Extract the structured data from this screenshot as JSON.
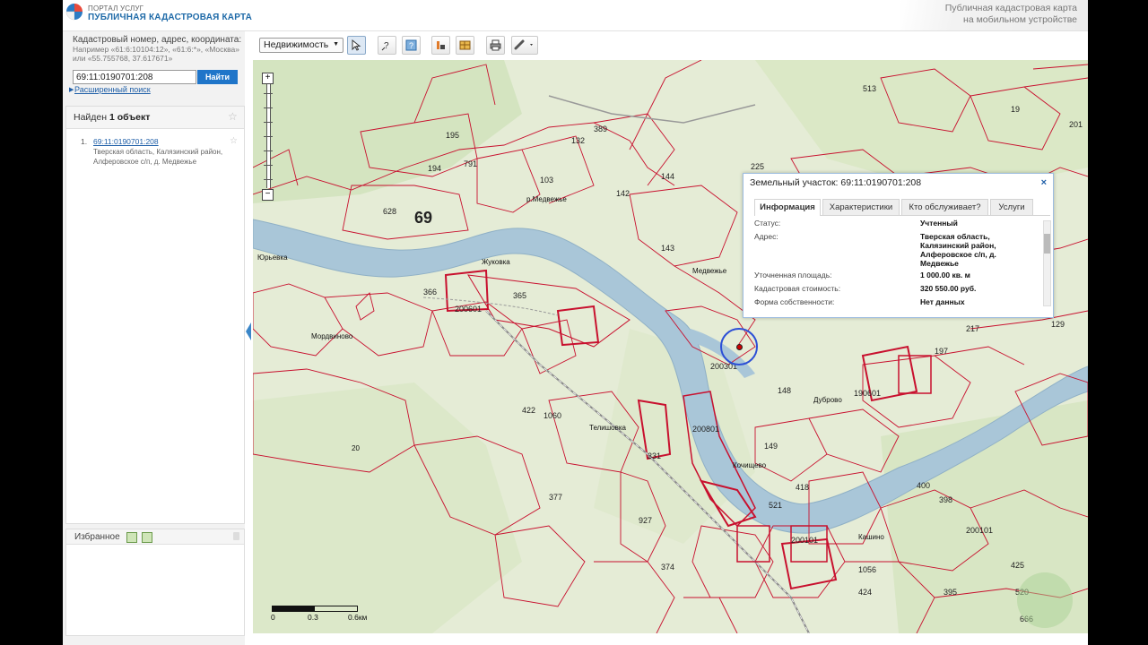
{
  "header": {
    "portal_label": "ПОРТАЛ УСЛУГ",
    "app_title": "ПУБЛИЧНАЯ КАДАСТРОВАЯ КАРТА",
    "mobile_link_line1": "Публичная кадастровая карта",
    "mobile_link_line2": "на мобильном устройстве"
  },
  "search": {
    "hint_title": "Кадастровый номер, адрес, координата:",
    "hint_examples": "Например «61:6:10104:12», «61:6:*», «Москва» или «55.755768, 37.617671»",
    "value": "69:11:0190701:208",
    "button_label": "Найти",
    "advanced_link": "Расширенный поиск"
  },
  "results": {
    "found_prefix": "Найден",
    "found_count": "1 объект",
    "items": [
      {
        "number": "1.",
        "cadastral_number": "69:11:0190701:208",
        "address": "Тверская область, Калязинский район, Алферовское с/п, д. Медвежье"
      }
    ]
  },
  "favorites": {
    "title": "Избранное"
  },
  "toolbar": {
    "layer_select_value": "Недвижимость"
  },
  "map": {
    "region_label": "69",
    "scale_labels": [
      "0",
      "0.3",
      "0.6км"
    ],
    "place_labels": [
      "р.Медвежье",
      "Медвежье",
      "Жуковка",
      "Мордвиново",
      "Юрьевка",
      "Дуброво",
      "Телишовка",
      "Кашино",
      "Кочищево",
      "20"
    ],
    "parcel_labels": [
      "513",
      "19",
      "201",
      "195",
      "389",
      "132",
      "194",
      "791",
      "103",
      "142",
      "144",
      "628",
      "143",
      "366",
      "365",
      "225",
      "197",
      "129",
      "217",
      "148",
      "149",
      "331",
      "377",
      "927",
      "374",
      "1056",
      "424",
      "395",
      "425",
      "666",
      "520",
      "521",
      "418",
      "422",
      "1060",
      "400",
      "398",
      "200101",
      "200101",
      "190601",
      "200801",
      "200301",
      "200601"
    ]
  },
  "popup": {
    "title": "Земельный участок: 69:11:0190701:208",
    "tabs": [
      "Информация",
      "Характеристики",
      "Кто обслуживает?",
      "Услуги"
    ],
    "rows": [
      {
        "key": "Статус:",
        "value": "Учтенный"
      },
      {
        "key": "Адрес:",
        "value": "Тверская область, Калязинский район, Алферовское с/п, д. Медвежье"
      },
      {
        "key": "Уточненная площадь:",
        "value": "1 000.00 кв. м"
      },
      {
        "key": "Кадастровая стоимость:",
        "value": "320 550.00 руб."
      },
      {
        "key": "Форма собственности:",
        "value": "Нет данных"
      }
    ]
  },
  "colors": {
    "accent": "#1f75c9",
    "parcel_border": "#c8102e",
    "river": "#a9c6d8",
    "forest": "#d9e8c4",
    "marker": "#2c4fd6"
  }
}
